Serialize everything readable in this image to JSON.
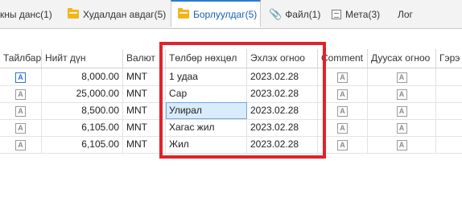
{
  "tabs": [
    {
      "label": "кны данс(1)",
      "icon": "none"
    },
    {
      "label": "Худалдан авдаг(5)",
      "icon": "folder-icon"
    },
    {
      "label": "Борлуулдаг(5)",
      "icon": "folder-icon",
      "active": true
    },
    {
      "label": "Файл(1)",
      "icon": "paperclip-icon"
    },
    {
      "label": "Мета(3)",
      "icon": "meta-icon"
    },
    {
      "label": "Лог",
      "icon": "none"
    }
  ],
  "columns": [
    "Тайлбар",
    "Нийт дүн",
    "Валют",
    "Төлбөр нөхцөл",
    "Эхлэх огноо",
    "Comment",
    "Дуусах огноо",
    "Гэрэ"
  ],
  "rows": [
    {
      "amount": "8,000.00",
      "currency": "MNT",
      "terms": "1 удаа",
      "start": "2023.02.28"
    },
    {
      "amount": "25,000.00",
      "currency": "MNT",
      "terms": "Сар",
      "start": "2023.02.28"
    },
    {
      "amount": "8,500.00",
      "currency": "MNT",
      "terms": "Улирал",
      "start": "2023.02.28"
    },
    {
      "amount": "6,105.00",
      "currency": "MNT",
      "terms": "Хагас жил",
      "start": "2023.02.28"
    },
    {
      "amount": "6,105.00",
      "currency": "MNT",
      "terms": "Жил",
      "start": "2023.02.28"
    }
  ],
  "colors": {
    "accent": "#2b7cd3",
    "highlight": "#e0232b",
    "folder": "#f2b51a"
  }
}
